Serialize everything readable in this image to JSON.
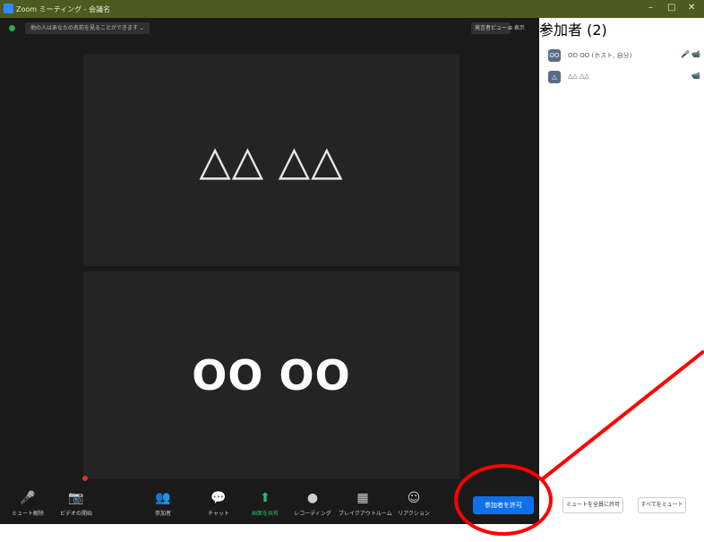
{
  "window": {
    "title": "Zoom ミーティング - 会議名",
    "controls": {
      "minimize": "–",
      "maximize": "□",
      "close": "✕"
    }
  },
  "topbar": {
    "notice": "他の人はあなたの名前を見ることができます ⌄",
    "speaker_view": "発言者ビュー",
    "view_menu": "⊞ 表示"
  },
  "tiles": [
    {
      "name": "△△ △△"
    },
    {
      "name": "OO OO"
    }
  ],
  "toolbar": {
    "items": [
      {
        "icon": "🎤",
        "label": "ミュート解除"
      },
      {
        "icon": "📷",
        "label": "ビデオの開始"
      },
      {
        "icon": "👥",
        "label": "参加者"
      },
      {
        "icon": "💬",
        "label": "チャット"
      },
      {
        "icon": "⬆",
        "label": "画面を共有"
      },
      {
        "icon": "●",
        "label": "レコーディング"
      },
      {
        "icon": "▦",
        "label": "ブレイクアウトルーム"
      },
      {
        "icon": "☺",
        "label": "リアクション"
      }
    ],
    "join_button": "参加者を許可"
  },
  "participants_panel": {
    "title": "参加者 (2)",
    "collapse": "⌄",
    "participants": [
      {
        "initial": "OO",
        "name": "OO OO (ホスト, 自分)",
        "mic": "🎤",
        "cam": "📹"
      },
      {
        "initial": "△",
        "name": "△△ △△",
        "mic": "",
        "cam": "📹"
      }
    ],
    "buttons": {
      "invite": "ミュートを全員に許可",
      "mute_all": "すべてをミュート"
    }
  },
  "colors": {
    "titlebar": "#4e5a22",
    "meeting_bg": "#1a1a1a",
    "tile_bg": "#242424",
    "accent_blue": "#0e71eb",
    "annotation_red": "#ff0000"
  }
}
